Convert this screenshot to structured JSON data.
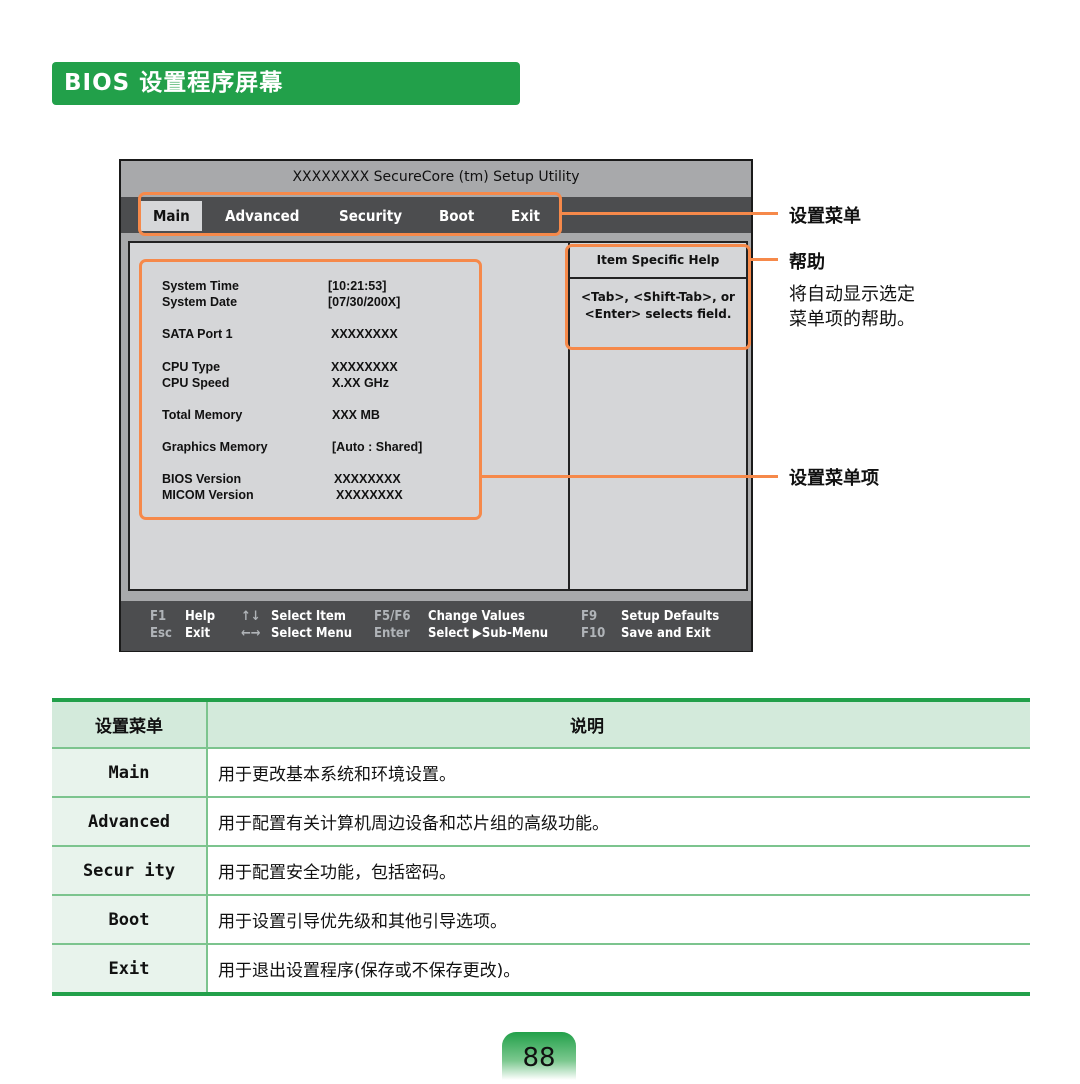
{
  "header": {
    "title": "BIOS 设置程序屏幕"
  },
  "bios": {
    "title": "XXXXXXXX SecureCore (tm) Setup Utility",
    "tabs": [
      {
        "label": "Main",
        "active": true
      },
      {
        "label": "Advanced",
        "active": false
      },
      {
        "label": "Security",
        "active": false
      },
      {
        "label": "Boot",
        "active": false
      },
      {
        "label": "Exit",
        "active": false
      }
    ],
    "fields": [
      {
        "label": "System Time",
        "value": "[10:21:53]"
      },
      {
        "label": "System Date",
        "value": "[07/30/200X]"
      },
      {
        "label": "SATA Port 1",
        "value": "XXXXXXXX"
      },
      {
        "label": "CPU Type",
        "value": "XXXXXXXX"
      },
      {
        "label": "CPU Speed",
        "value": "X.XX GHz"
      },
      {
        "label": "Total Memory",
        "value": "XXX MB"
      },
      {
        "label": "Graphics Memory",
        "value": "[Auto : Shared]"
      },
      {
        "label": "BIOS Version",
        "value": "XXXXXXXX"
      },
      {
        "label": "MICOM Version",
        "value": "XXXXXXXX"
      }
    ],
    "help": {
      "heading": "Item Specific Help",
      "line1": "<Tab>, <Shift-Tab>, or",
      "line2": "<Enter> selects field."
    },
    "footer": {
      "f1_key": "F1",
      "f1_desc": "Help",
      "esc_key": "Esc",
      "esc_desc": "Exit",
      "updown_key": "↑↓",
      "updown_desc": "Select Item",
      "leftright_key": "←→",
      "leftright_desc": "Select Menu",
      "f5f6_key": "F5/F6",
      "f5f6_desc": "Change Values",
      "enter_key": "Enter",
      "enter_desc": "Select ▶Sub-Menu",
      "f9_key": "F9",
      "f9_desc": "Setup Defaults",
      "f10_key": "F10",
      "f10_desc": "Save and Exit"
    }
  },
  "callouts": {
    "menu": "设置菜单",
    "help_title": "帮助",
    "help_line1": "将自动显示选定",
    "help_line2": "菜单项的帮助。",
    "menu_items": "设置菜单项"
  },
  "table": {
    "headers": [
      "设置菜单",
      "说明"
    ],
    "rows": [
      {
        "menu": "Main",
        "desc": "用于更改基本系统和环境设置。"
      },
      {
        "menu": "Advanced",
        "desc": "用于配置有关计算机周边设备和芯片组的高级功能。"
      },
      {
        "menu": "Secur ity",
        "desc": "用于配置安全功能，包括密码。"
      },
      {
        "menu": "Boot",
        "desc": "用于设置引导优先级和其他引导选项。"
      },
      {
        "menu": "Exit",
        "desc": "用于退出设置程序(保存或不保存更改)。"
      }
    ]
  },
  "page_number": "88"
}
